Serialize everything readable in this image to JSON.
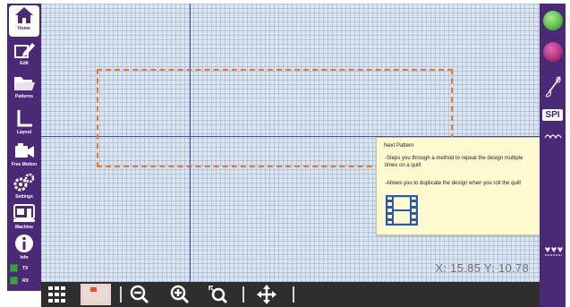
{
  "sidebar": {
    "items": [
      {
        "label": "Home",
        "icon": "home-icon"
      },
      {
        "label": "Edit",
        "icon": "edit-icon"
      },
      {
        "label": "Patterns",
        "icon": "folder-icon"
      },
      {
        "label": "Layout",
        "icon": "layout-icon"
      },
      {
        "label": "Free Motion",
        "icon": "camera-icon"
      },
      {
        "label": "Settings",
        "icon": "gears-icon"
      },
      {
        "label": "Machine",
        "icon": "sewing-machine-icon"
      },
      {
        "label": "Info",
        "icon": "info-icon"
      }
    ],
    "toggles": [
      {
        "label": "TX",
        "color": "#3ca23c"
      },
      {
        "label": "RX",
        "color": "#3ca23c"
      }
    ]
  },
  "canvas": {
    "coords": "X: 15.85 Y: 10.78",
    "design_border_color": "#e8772a",
    "axis_color": "#3d4ea8"
  },
  "tooltip": {
    "title": "Next Pattern",
    "line1": "-Steps you through a method to repeat the design multiple times on a quilt",
    "line2": "-Allows you to duplicate the design when you roll the quilt",
    "icon": "film-strip-icon"
  },
  "toolbar": {
    "tools": [
      "grid-icon",
      "pattern-thumbnail-icon",
      "zoom-out-icon",
      "zoom-in-icon",
      "zoom-fit-icon",
      "move-icon"
    ]
  },
  "right_bar": {
    "spi_label": "SPI",
    "status_colors": [
      "#5ec94e",
      "#c0297e"
    ]
  },
  "colors": {
    "sidebar": "#4a2a77",
    "canvas": "#dbe6f2",
    "toolbar": "#2e2e2e",
    "tooltip": "#fdfad0"
  }
}
